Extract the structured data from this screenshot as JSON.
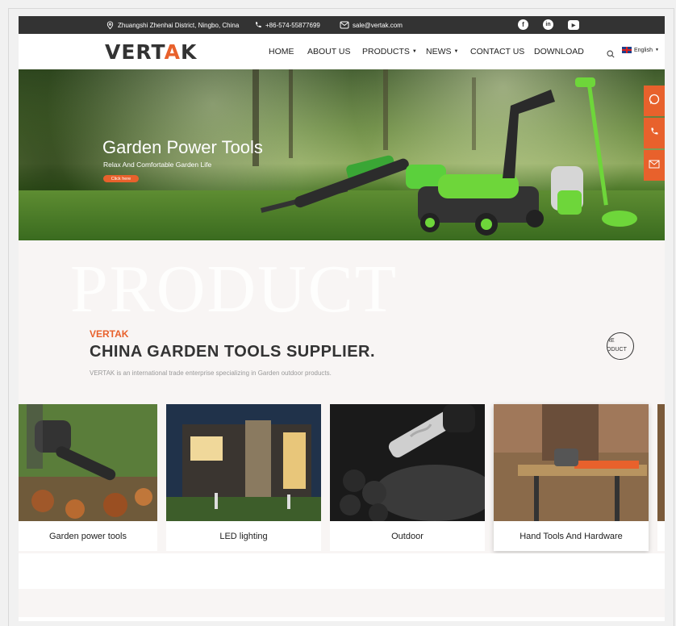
{
  "topbar": {
    "address": "Zhuangshi Zhenhai District, Ningbo, China",
    "phone": "+86-574-55877699",
    "email": "sale@vertak.com",
    "social": [
      {
        "icon": "facebook-icon",
        "glyph": "f"
      },
      {
        "icon": "linkedin-icon",
        "glyph": "in"
      },
      {
        "icon": "youtube-icon",
        "glyph": "▶"
      }
    ]
  },
  "header": {
    "logo_pre": "VERT",
    "logo_accent": "A",
    "logo_post": "K",
    "nav": [
      {
        "label": "HOME",
        "dropdown": false
      },
      {
        "label": "ABOUT US",
        "dropdown": false
      },
      {
        "label": "PRODUCTS",
        "dropdown": true
      },
      {
        "label": "NEWS",
        "dropdown": true
      },
      {
        "label": "CONTACT US",
        "dropdown": false
      },
      {
        "label": "DOWNLOAD",
        "dropdown": false
      }
    ],
    "language": "English"
  },
  "hero": {
    "title": "Garden Power Tools",
    "subtitle": "Relax And Comfortable Garden Life",
    "cta": "Click here"
  },
  "side_contact": [
    {
      "icon": "whatsapp-icon"
    },
    {
      "icon": "phone-icon"
    },
    {
      "icon": "email-icon"
    }
  ],
  "product_section": {
    "watermark": "PRODUCT",
    "eyebrow": "VERTAK",
    "title": "CHINA GARDEN TOOLS SUPPLIER.",
    "description": "VERTAK is an international trade enterprise specializing in Garden outdoor products.",
    "more_line1": "RE",
    "more_line2": "ODUCT"
  },
  "categories": [
    {
      "label": "Garden power tools"
    },
    {
      "label": "LED lighting"
    },
    {
      "label": "Outdoor"
    },
    {
      "label": "Hand Tools And Hardware"
    }
  ],
  "colors": {
    "accent": "#e8612c",
    "topbar": "#333333",
    "section_bg": "#f8f5f4"
  }
}
